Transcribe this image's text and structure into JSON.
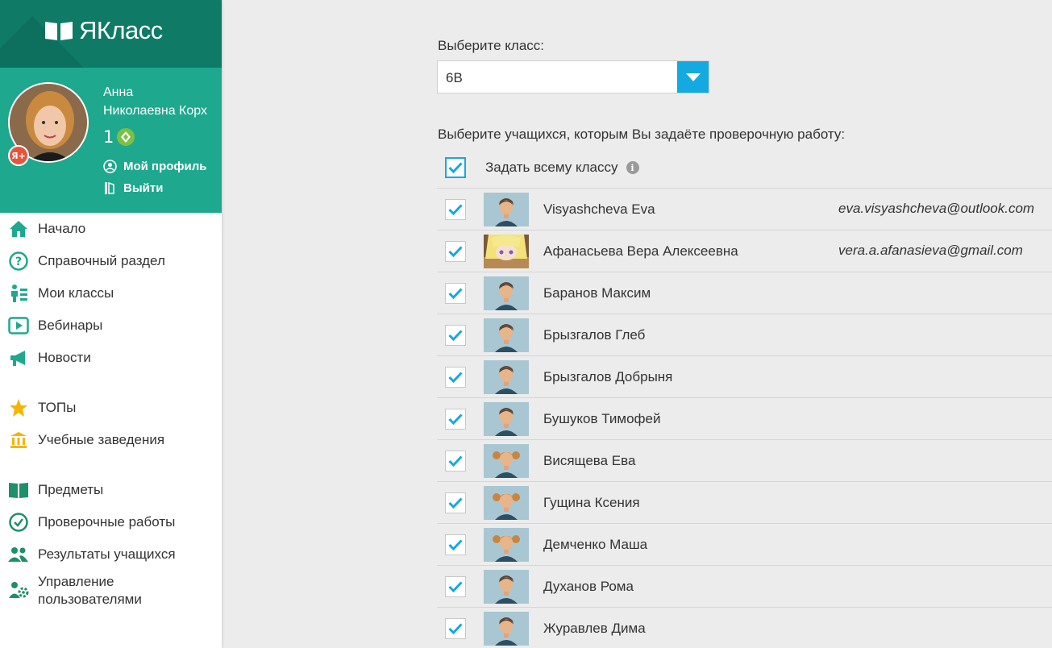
{
  "brand": {
    "name": "ЯКласс"
  },
  "user": {
    "name_line1": "Анна",
    "name_line2": "Николаевна Корх",
    "points": "1",
    "badge": "Я+",
    "profile_link": "Мой профиль",
    "logout_link": "Выйти"
  },
  "nav": {
    "items": [
      {
        "label": "Начало",
        "icon": "home-icon"
      },
      {
        "label": "Справочный раздел",
        "icon": "help-icon"
      },
      {
        "label": "Мои классы",
        "icon": "classes-icon"
      },
      {
        "label": "Вебинары",
        "icon": "webinar-icon"
      },
      {
        "label": "Новости",
        "icon": "news-icon"
      },
      {
        "label": "ТОПы",
        "icon": "star-icon"
      },
      {
        "label": "Учебные заведения",
        "icon": "school-icon"
      },
      {
        "label": "Предметы",
        "icon": "book-icon"
      },
      {
        "label": "Проверочные работы",
        "icon": "check-circle-icon"
      },
      {
        "label": "Результаты учащихся",
        "icon": "users-icon"
      },
      {
        "label": "Управление",
        "label2": "пользователями",
        "icon": "user-settings-icon"
      }
    ]
  },
  "form": {
    "class_label": "Выберите класс:",
    "class_value": "6В",
    "students_label": "Выберите учащихся, которым Вы задаёте проверочную работу:",
    "whole_class_label": "Задать всему классу",
    "info_glyph": "i"
  },
  "students": [
    {
      "name": "Visyashcheva Eva",
      "email": "eva.visyashcheva@outlook.com",
      "avatar": "boy"
    },
    {
      "name": "Афанасьева Вера Алексеевна",
      "email": "vera.a.afanasieva@gmail.com",
      "avatar": "anime"
    },
    {
      "name": "Баранов Максим",
      "email": "",
      "avatar": "boy"
    },
    {
      "name": "Брызгалов Глеб",
      "email": "",
      "avatar": "boy"
    },
    {
      "name": "Брызгалов Добрыня",
      "email": "",
      "avatar": "boy"
    },
    {
      "name": "Бушуков Тимофей",
      "email": "",
      "avatar": "boy"
    },
    {
      "name": "Висящева Ева",
      "email": "",
      "avatar": "girl"
    },
    {
      "name": "Гущина Ксения",
      "email": "",
      "avatar": "girl"
    },
    {
      "name": "Демченко Маша",
      "email": "",
      "avatar": "girl"
    },
    {
      "name": "Духанов Рома",
      "email": "",
      "avatar": "boy"
    },
    {
      "name": "Журавлев Дима",
      "email": "",
      "avatar": "boy"
    }
  ],
  "colors": {
    "brand_dark": "#0f7a66",
    "brand": "#1ea88e",
    "accent": "#14a9e0"
  }
}
